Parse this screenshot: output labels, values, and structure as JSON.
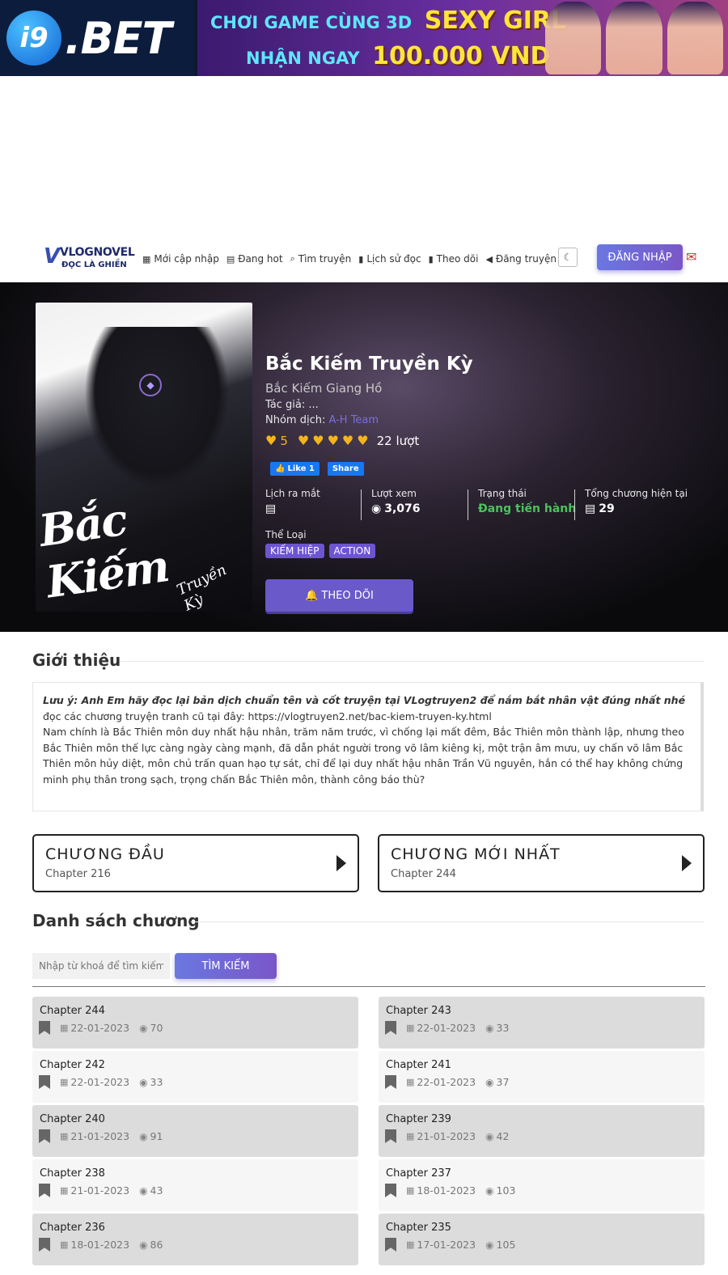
{
  "banner": {
    "logo_mark": "i9",
    "logo_text": ".BET",
    "line1_small": "CHƠI GAME CÙNG 3D",
    "line1_big": "SEXY GIRL",
    "line2_small": "NHẬN NGAY",
    "line2_big": "100.000 VND"
  },
  "nav": {
    "logo_top": "VLOGNOVEL",
    "logo_bottom": "ĐỌC LÀ GHIỀN",
    "items": [
      {
        "label": "Mới cập nhập",
        "icon": "grid-icon"
      },
      {
        "label": "Đang hot",
        "icon": "newspaper-icon"
      },
      {
        "label": "Tìm truyện",
        "icon": "search-icon"
      },
      {
        "label": "Lịch sử đọc",
        "icon": "book-icon"
      },
      {
        "label": "Theo dõi",
        "icon": "bookmark-icon"
      },
      {
        "label": "Đăng truyện",
        "icon": "megaphone-icon"
      }
    ],
    "login": "ĐĂNG NHẬP"
  },
  "story": {
    "cover_title": "Bắc Kiếm",
    "cover_subtitle": "Truyền Kỳ",
    "title": "Bắc Kiếm Truyền Kỳ",
    "alt_title": "Bắc Kiếm Giang Hồ",
    "author_label": "Tác giả:",
    "author": "...",
    "group_label": "Nhóm dịch:",
    "group": "A-H Team",
    "rating_score": "5",
    "rating_stars": 5,
    "rating_votes": "22 lượt",
    "fb_like": "Like 1",
    "fb_share": "Share",
    "stats": {
      "release_label": "Lịch ra mắt",
      "views_label": "Lượt xem",
      "views": "3,076",
      "status_label": "Trạng thái",
      "status": "Đang tiến hành",
      "chapters_label": "Tổng chương hiện tại",
      "chapters": "29"
    },
    "genres_label": "Thể Loại",
    "genres": [
      "KIẾM HIỆP",
      "ACTION"
    ],
    "follow": "THEO DÕI"
  },
  "intro": {
    "title": "Giới thiệu",
    "note": "Lưu ý: Anh Em hãy đọc lại bản dịch chuẩn tên và cốt truyện tại VLogtruyen2 để nắm bắt nhân vật đúng nhất nhé",
    "old_link": "đọc các chương truyện tranh cũ tại đây: https://vlogtruyen2.net/bac-kiem-truyen-ky.html",
    "body": "Nam chính là Bắc Thiên môn duy nhất hậu nhân, trăm năm trước, vì chống lại mất đêm, Bắc Thiên môn thành lập, nhưng theo Bắc Thiên môn thế lực càng ngày càng mạnh, đã dẫn phát người trong võ lâm kiêng kị, một trận âm mưu, uy chấn võ lâm Bắc Thiên môn hủy diệt, môn chủ trấn quan hạo tự sát, chỉ để lại duy nhất hậu nhân Trần Vũ nguyên, hắn có thể hay không chứng minh phụ thân trong sạch, trọng chấn Bắc Thiên môn, thành công báo thù?"
  },
  "first_chapter": {
    "head": "CHƯƠNG ĐẦU",
    "sub": "Chapter 216"
  },
  "latest_chapter": {
    "head": "CHƯƠNG MỚI NHẤT",
    "sub": "Chapter 244"
  },
  "chapter_list": {
    "title": "Danh sách chương",
    "search_placeholder": "Nhập từ khoá để tìm kiếm ...",
    "search_button": "TÌM KIẾM",
    "items": [
      {
        "name": "Chapter 244",
        "date": "22-01-2023",
        "views": "70"
      },
      {
        "name": "Chapter 243",
        "date": "22-01-2023",
        "views": "33"
      },
      {
        "name": "Chapter 242",
        "date": "22-01-2023",
        "views": "33"
      },
      {
        "name": "Chapter 241",
        "date": "22-01-2023",
        "views": "37"
      },
      {
        "name": "Chapter 240",
        "date": "21-01-2023",
        "views": "91"
      },
      {
        "name": "Chapter 239",
        "date": "21-01-2023",
        "views": "42"
      },
      {
        "name": "Chapter 238",
        "date": "21-01-2023",
        "views": "43"
      },
      {
        "name": "Chapter 237",
        "date": "18-01-2023",
        "views": "103"
      },
      {
        "name": "Chapter 236",
        "date": "18-01-2023",
        "views": "86"
      },
      {
        "name": "Chapter 235",
        "date": "17-01-2023",
        "views": "105"
      }
    ]
  }
}
